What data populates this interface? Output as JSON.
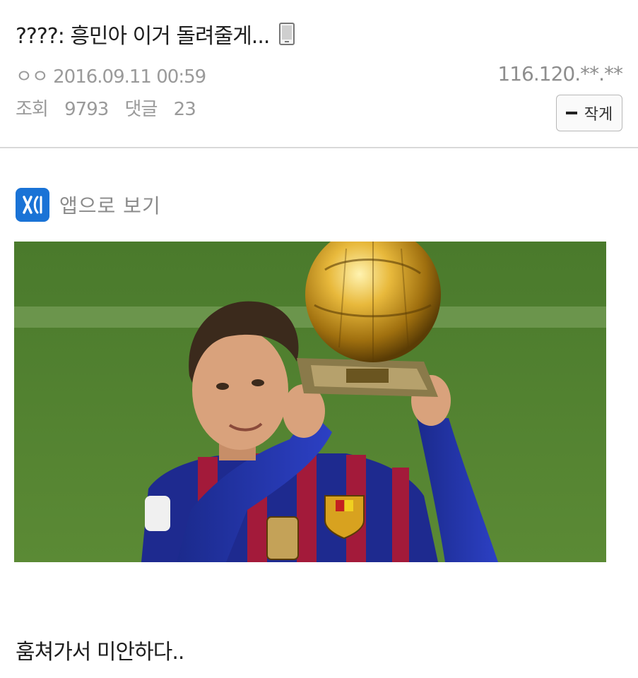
{
  "post": {
    "title": "????: 흥민아 이거 돌려줄게...",
    "author": "ㅇㅇ",
    "datetime": "2016.09.11 00:59",
    "ip": "116.120.**.**",
    "views_label": "조회",
    "views": "9793",
    "comments_label": "댓글",
    "comments": "23",
    "body_text": "훔쳐가서 미안하다.."
  },
  "controls": {
    "font_small_label": "작게",
    "app_view_label": "앱으로 보기"
  },
  "icons": {
    "mobile": "mobile-phone-icon",
    "app": "app-logo-icon",
    "minus": "minus-icon"
  },
  "colors": {
    "app_icon_bg": "#1a73d6",
    "divider": "#d9d9d9",
    "meta_text": "#9a9a9a"
  }
}
